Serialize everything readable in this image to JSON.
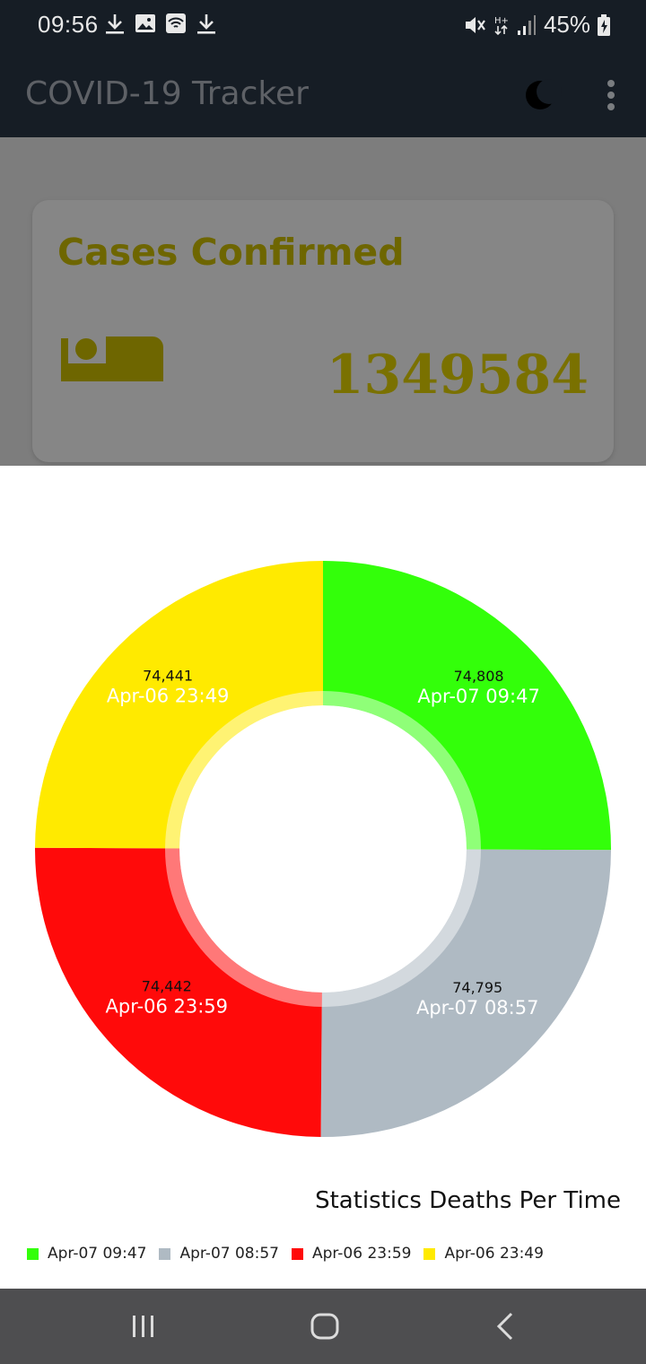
{
  "status_bar": {
    "time": "09:56",
    "battery": "45%"
  },
  "app_bar": {
    "title": "COVID-19 Tracker"
  },
  "card": {
    "title": "Cases Confirmed",
    "value": "1349584"
  },
  "chart_data": {
    "type": "pie",
    "title": "Statistics Deaths Per Time",
    "legend_position": "bottom-left",
    "slices": [
      {
        "label": "Apr-07 09:47",
        "value": 74808,
        "value_label": "74,808",
        "color": "#33ff0a"
      },
      {
        "label": "Apr-07 08:57",
        "value": 74795,
        "value_label": "74,795",
        "color": "#afbac3"
      },
      {
        "label": "Apr-06 23:59",
        "value": 74442,
        "value_label": "74,442",
        "color": "#ff0a0a"
      },
      {
        "label": "Apr-06 23:49",
        "value": 74441,
        "value_label": "74,441",
        "color": "#ffea00"
      }
    ]
  },
  "colors": {
    "bar_bg": "#161d25",
    "card_title": "#6e6600"
  }
}
